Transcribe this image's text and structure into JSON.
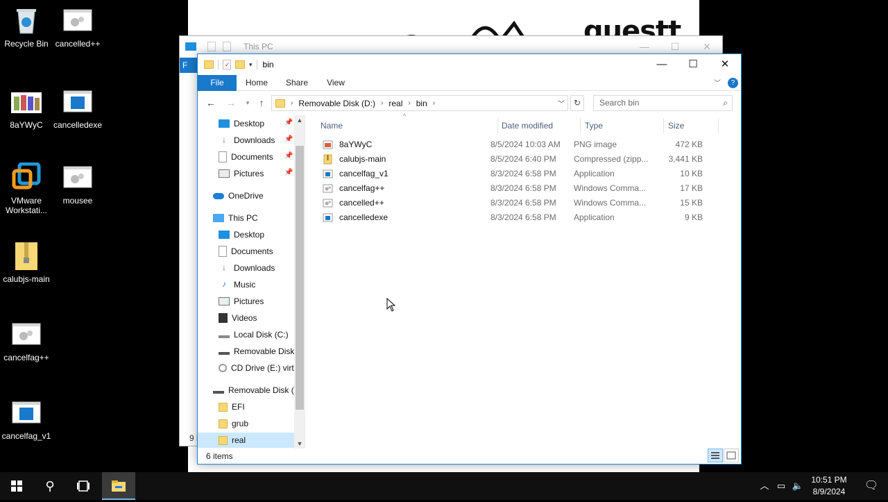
{
  "desktop": {
    "wallpaper_text": "guestt",
    "icons": [
      {
        "label": "Recycle Bin",
        "icon": "recycle-bin-icon"
      },
      {
        "label": "cancelled++",
        "icon": "cmd-file-icon"
      },
      {
        "label": "8aYWyC",
        "icon": "image-file-icon"
      },
      {
        "label": "cancelledexe",
        "icon": "application-icon"
      },
      {
        "label": "VMware Workstati...",
        "icon": "vmware-icon"
      },
      {
        "label": "mousee",
        "icon": "cmd-file-icon"
      },
      {
        "label": "calubjs-main",
        "icon": "zip-folder-icon"
      },
      {
        "label": "cancelfag++",
        "icon": "cmd-file-icon"
      },
      {
        "label": "cancelfag_v1",
        "icon": "application-icon"
      }
    ]
  },
  "back_window": {
    "title": "This PC",
    "ribbon_stub": "F",
    "footer_stub": "9 i"
  },
  "window": {
    "title": "bin",
    "controls": {
      "minimize": "—",
      "maximize": "☐",
      "close": "✕"
    },
    "ribbon": {
      "tabs": [
        "File",
        "Home",
        "Share",
        "View"
      ]
    },
    "address": {
      "segments": [
        "Removable Disk (D:)",
        "real",
        "bin"
      ]
    },
    "search": {
      "placeholder": "Search bin"
    },
    "nav": [
      {
        "label": "Desktop",
        "icon": "desktop-icon",
        "pinned": true
      },
      {
        "label": "Downloads",
        "icon": "download-icon",
        "pinned": true
      },
      {
        "label": "Documents",
        "icon": "documents-icon",
        "pinned": true
      },
      {
        "label": "Pictures",
        "icon": "pictures-icon",
        "pinned": true
      },
      {
        "label": "OneDrive",
        "icon": "cloud-icon"
      },
      {
        "label": "This PC",
        "icon": "computer-icon"
      },
      {
        "label": "Desktop",
        "icon": "desktop-icon"
      },
      {
        "label": "Documents",
        "icon": "documents-icon"
      },
      {
        "label": "Downloads",
        "icon": "download-icon"
      },
      {
        "label": "Music",
        "icon": "music-icon"
      },
      {
        "label": "Pictures",
        "icon": "pictures-icon"
      },
      {
        "label": "Videos",
        "icon": "video-icon"
      },
      {
        "label": "Local Disk (C:)",
        "icon": "local-disk-icon"
      },
      {
        "label": "Removable Disk",
        "icon": "removable-disk-icon"
      },
      {
        "label": "CD Drive (E:) virt",
        "icon": "cd-drive-icon"
      },
      {
        "label": "Removable Disk (D",
        "icon": "removable-disk-icon"
      },
      {
        "label": "EFI",
        "icon": "folder-icon"
      },
      {
        "label": "grub",
        "icon": "folder-icon"
      },
      {
        "label": "real",
        "icon": "folder-icon",
        "selected": true
      }
    ],
    "columns": [
      "Name",
      "Date modified",
      "Type",
      "Size"
    ],
    "files": [
      {
        "name": "8aYWyC",
        "date": "8/5/2024 10:03 AM",
        "type": "PNG image",
        "size": "472 KB",
        "icon": "image-file-icon"
      },
      {
        "name": "calubjs-main",
        "date": "8/5/2024 6:40 PM",
        "type": "Compressed (zipp...",
        "size": "3,441 KB",
        "icon": "zip-folder-icon"
      },
      {
        "name": "cancelfag_v1",
        "date": "8/3/2024 6:58 PM",
        "type": "Application",
        "size": "10 KB",
        "icon": "application-icon"
      },
      {
        "name": "cancelfag++",
        "date": "8/3/2024 6:58 PM",
        "type": "Windows Comma...",
        "size": "17 KB",
        "icon": "cmd-file-icon"
      },
      {
        "name": "cancelled++",
        "date": "8/3/2024 6:58 PM",
        "type": "Windows Comma...",
        "size": "15 KB",
        "icon": "cmd-file-icon"
      },
      {
        "name": "cancelledexe",
        "date": "8/3/2024 6:58 PM",
        "type": "Application",
        "size": "9 KB",
        "icon": "application-icon"
      }
    ],
    "status": "6 items"
  },
  "taskbar": {
    "time": "10:51 PM",
    "date": "8/9/2024"
  },
  "colors": {
    "accent": "#1979ca",
    "selection": "#cce8ff",
    "taskbar": "#101010",
    "folder": "#f8d775"
  }
}
